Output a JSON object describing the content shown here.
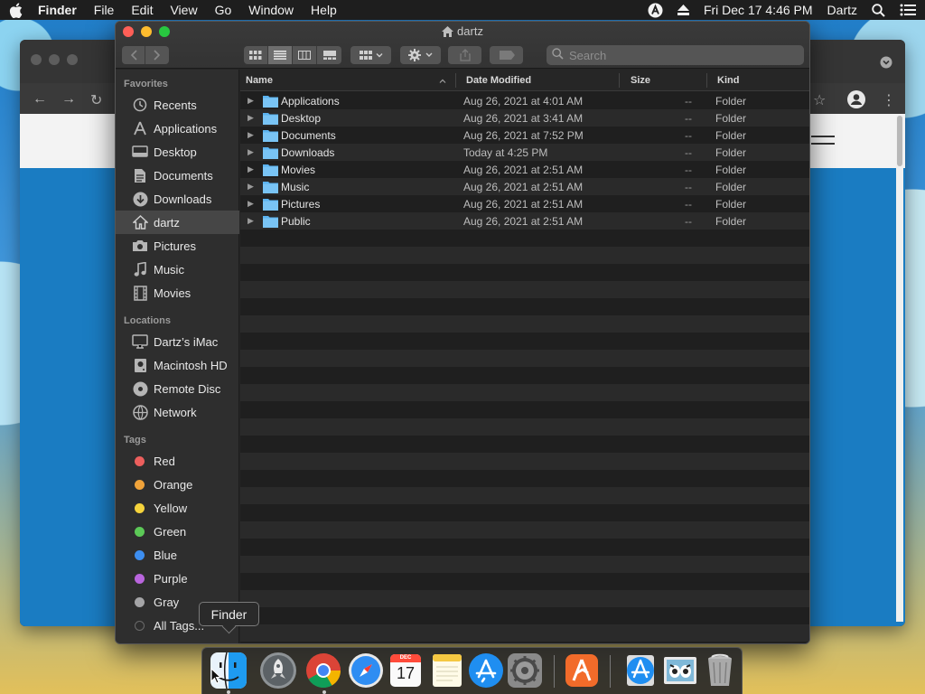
{
  "menubar": {
    "app_name": "Finder",
    "menus": [
      "File",
      "Edit",
      "View",
      "Go",
      "Window",
      "Help"
    ],
    "clock": "Fri Dec 17  4:46 PM",
    "user": "Dartz"
  },
  "finder": {
    "title": "dartz",
    "search_placeholder": "Search",
    "sidebar": {
      "favorites_label": "Favorites",
      "favorites": [
        {
          "label": "Recents",
          "icon": "clock-icon"
        },
        {
          "label": "Applications",
          "icon": "applications-icon"
        },
        {
          "label": "Desktop",
          "icon": "desktop-icon"
        },
        {
          "label": "Documents",
          "icon": "document-icon"
        },
        {
          "label": "Downloads",
          "icon": "download-icon"
        },
        {
          "label": "dartz",
          "icon": "home-icon",
          "selected": true
        },
        {
          "label": "Pictures",
          "icon": "camera-icon"
        },
        {
          "label": "Music",
          "icon": "music-icon"
        },
        {
          "label": "Movies",
          "icon": "film-icon"
        }
      ],
      "locations_label": "Locations",
      "locations": [
        {
          "label": "Dartz’s iMac",
          "icon": "imac-icon"
        },
        {
          "label": "Macintosh HD",
          "icon": "disk-icon"
        },
        {
          "label": "Remote Disc",
          "icon": "remote-disc-icon"
        },
        {
          "label": "Network",
          "icon": "network-icon"
        }
      ],
      "tags_label": "Tags",
      "tags": [
        {
          "label": "Red",
          "color": "#ec5f5d"
        },
        {
          "label": "Orange",
          "color": "#f0a33a"
        },
        {
          "label": "Yellow",
          "color": "#f5d33c"
        },
        {
          "label": "Green",
          "color": "#5cc957"
        },
        {
          "label": "Blue",
          "color": "#3d8ef0"
        },
        {
          "label": "Purple",
          "color": "#b965dd"
        },
        {
          "label": "Gray",
          "color": "#a4a4a6"
        },
        {
          "label": "All Tags...",
          "color": "#4a4a4a"
        }
      ]
    },
    "columns": {
      "name": "Name",
      "date": "Date Modified",
      "size": "Size",
      "kind": "Kind"
    },
    "files": [
      {
        "name": "Applications",
        "date": "Aug 26, 2021 at 4:01 AM",
        "size": "--",
        "kind": "Folder"
      },
      {
        "name": "Desktop",
        "date": "Aug 26, 2021 at 3:41 AM",
        "size": "--",
        "kind": "Folder"
      },
      {
        "name": "Documents",
        "date": "Aug 26, 2021 at 7:52 PM",
        "size": "--",
        "kind": "Folder"
      },
      {
        "name": "Downloads",
        "date": "Today at 4:25 PM",
        "size": "--",
        "kind": "Folder"
      },
      {
        "name": "Movies",
        "date": "Aug 26, 2021 at 2:51 AM",
        "size": "--",
        "kind": "Folder"
      },
      {
        "name": "Music",
        "date": "Aug 26, 2021 at 2:51 AM",
        "size": "--",
        "kind": "Folder"
      },
      {
        "name": "Pictures",
        "date": "Aug 26, 2021 at 2:51 AM",
        "size": "--",
        "kind": "Folder"
      },
      {
        "name": "Public",
        "date": "Aug 26, 2021 at 2:51 AM",
        "size": "--",
        "kind": "Folder"
      }
    ]
  },
  "dock": {
    "tooltip": "Finder",
    "calendar_month": "DEC",
    "calendar_day": "17",
    "apps": [
      "finder-icon",
      "launchpad-icon",
      "chrome-icon",
      "safari-icon",
      "calendar-icon",
      "notes-icon",
      "app-store-icon",
      "system-preferences-icon",
      "app-icon",
      "downloads-stack-icon",
      "preview-stack-icon",
      "trash-icon"
    ]
  },
  "colors": {
    "folder": "#5bb3f0",
    "selection": "#464646"
  }
}
